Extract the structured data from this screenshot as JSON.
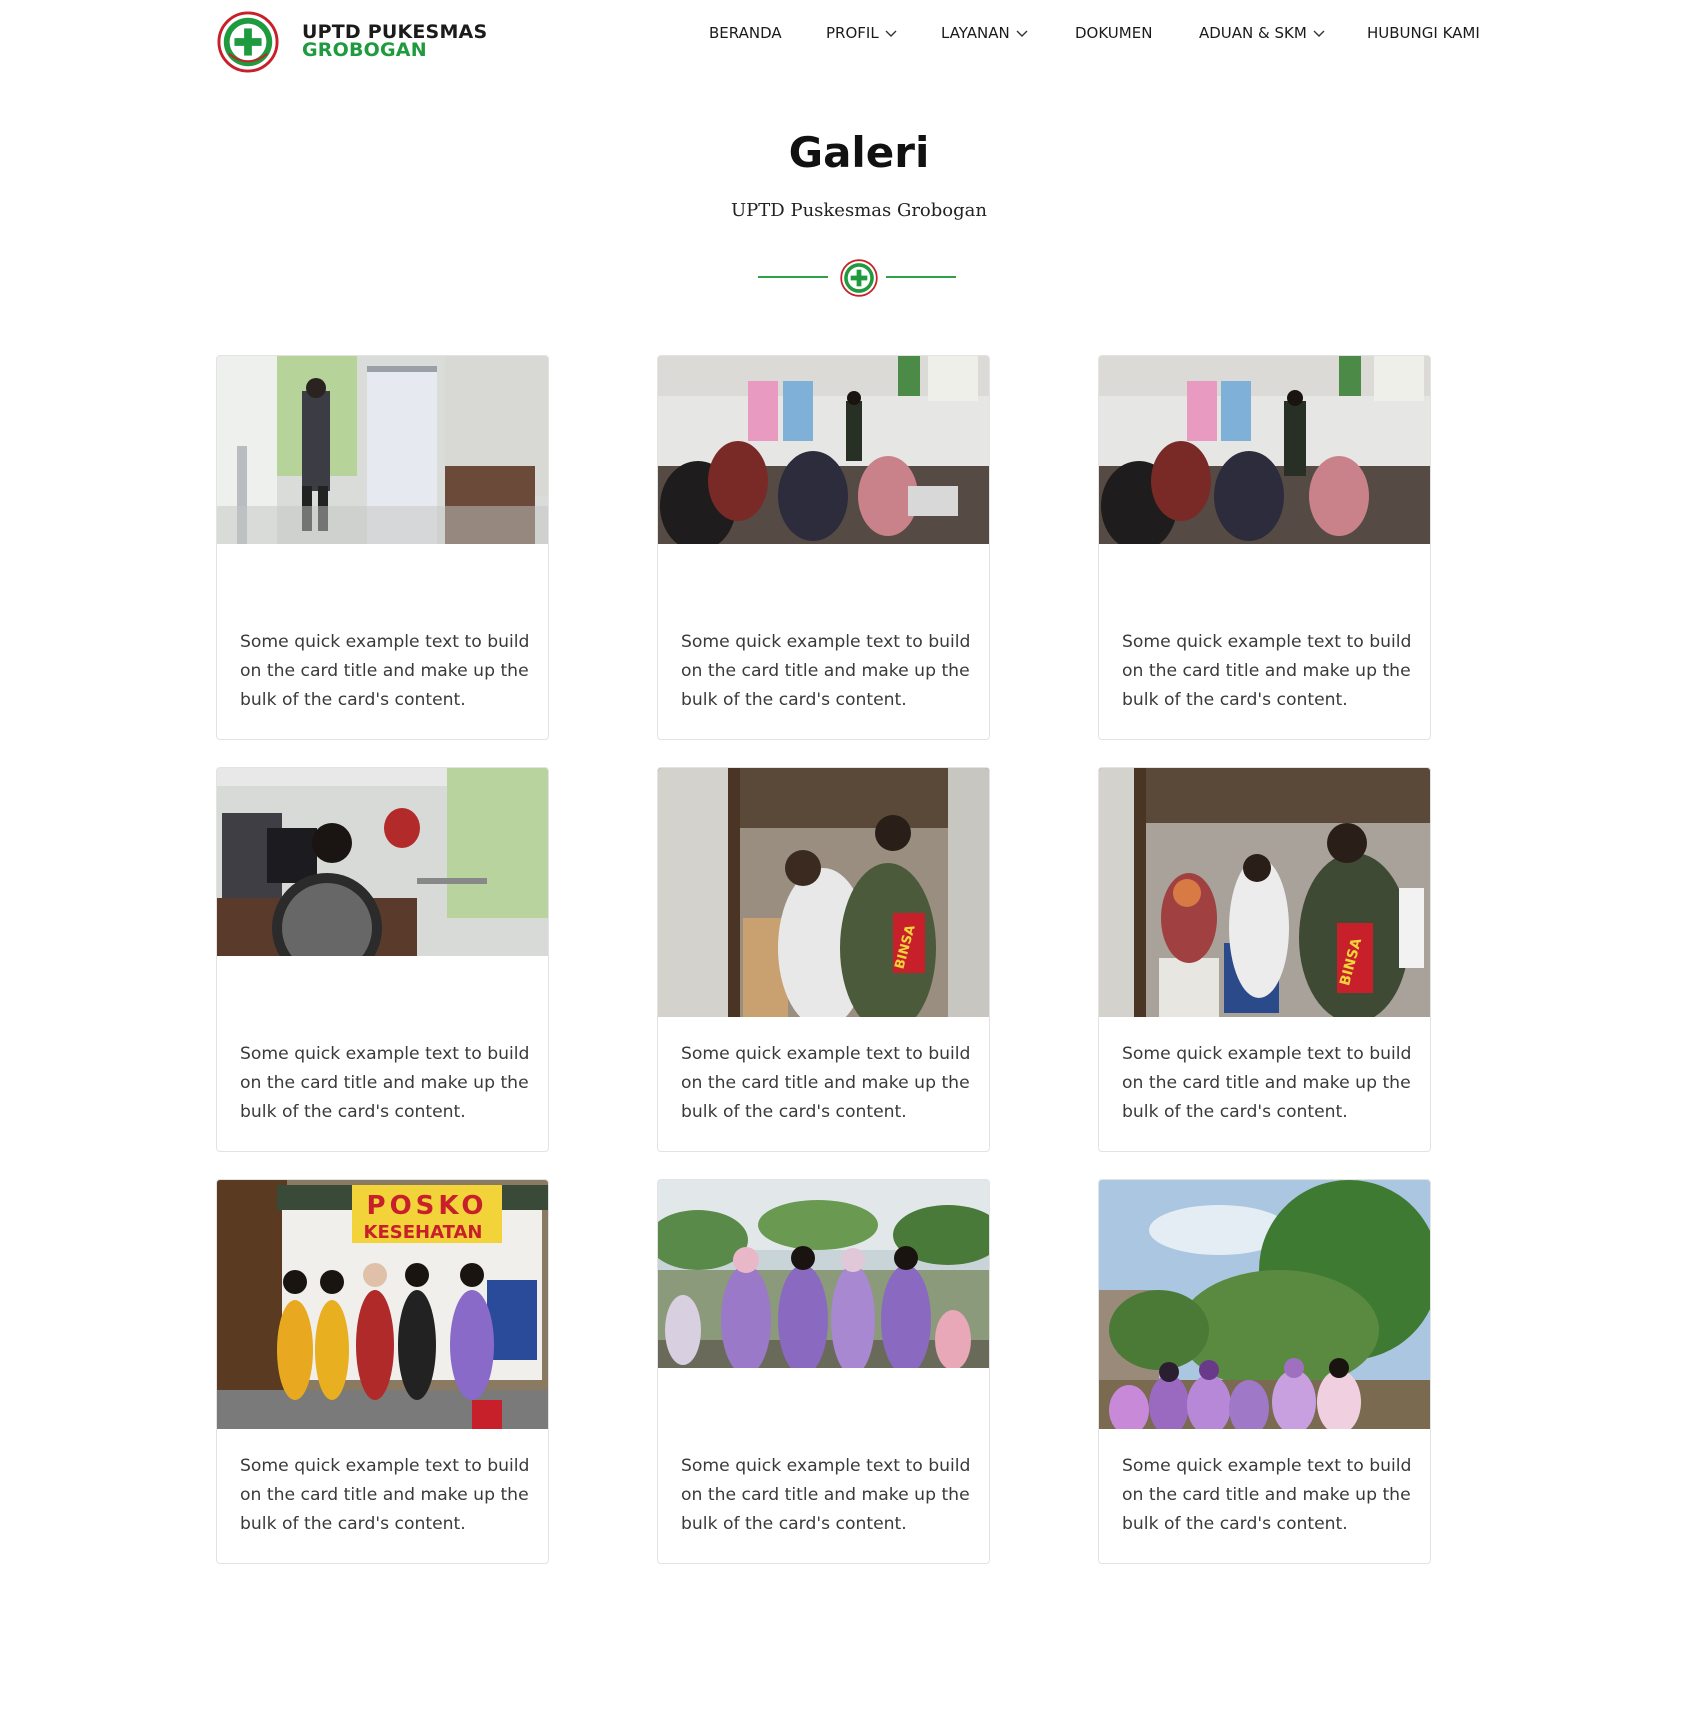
{
  "brand": {
    "line1": "UPTD PUKESMAS",
    "line2": "GROBOGAN",
    "logo_icon": "puskesmas-logo-icon",
    "colors": {
      "green": "#1f9a3e",
      "red": "#c8202b",
      "dark": "#1b1b1b"
    }
  },
  "nav": {
    "items": [
      {
        "label": "BERANDA",
        "dropdown": false
      },
      {
        "label": "PROFIL",
        "dropdown": true
      },
      {
        "label": "LAYANAN",
        "dropdown": true
      },
      {
        "label": "DOKUMEN",
        "dropdown": false
      },
      {
        "label": "ADUAN & SKM",
        "dropdown": true
      },
      {
        "label": "HUBUNGI KAMI",
        "dropdown": false
      }
    ]
  },
  "page": {
    "title": "Galeri",
    "subtitle": "UPTD Puskesmas Grobogan",
    "divider_icon": "puskesmas-logo-icon"
  },
  "gallery": {
    "cards": [
      {
        "text": "Some quick example text to build on the card title and make up the bulk of the card's content."
      },
      {
        "text": "Some quick example text to build on the card title and make up the bulk of the card's content."
      },
      {
        "text": "Some quick example text to build on the card title and make up the bulk of the card's content."
      },
      {
        "text": "Some quick example text to build on the card title and make up the bulk of the card's content."
      },
      {
        "text": "Some quick example text to build on the card title and make up the bulk of the card's content."
      },
      {
        "text": "Some quick example text to build on the card title and make up the bulk of the card's content."
      },
      {
        "text": "Some quick example text to build on the card title and make up the bulk of the card's content."
      },
      {
        "text": "Some quick example text to build on the card title and make up the bulk of the card's content."
      },
      {
        "text": "Some quick example text to build on the card title and make up the bulk of the card's content."
      }
    ],
    "posko_sign": {
      "line1": "POSKO",
      "line2": "KESEHATAN"
    },
    "badge_text": "BINSA"
  }
}
